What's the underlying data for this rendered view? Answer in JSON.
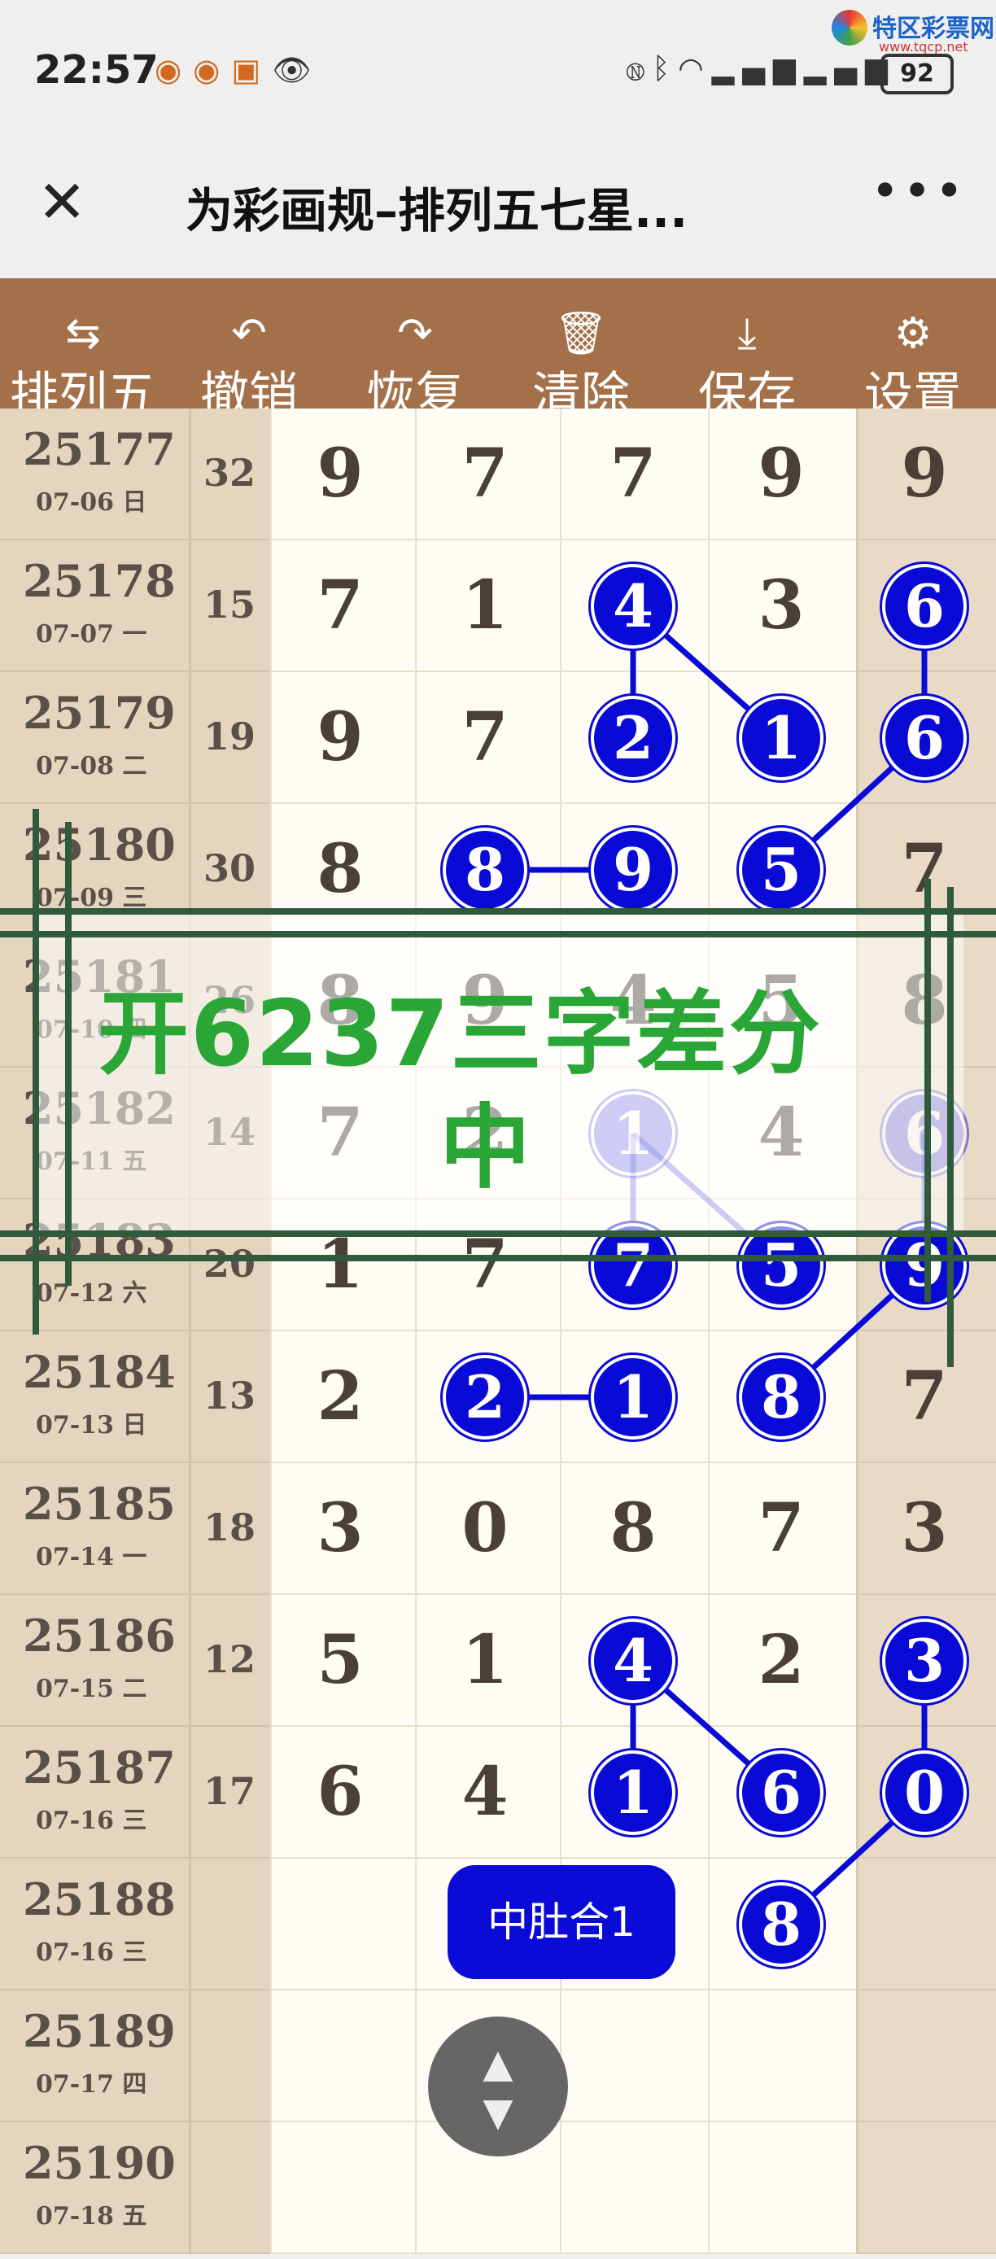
{
  "status_bar": {
    "time": "22:57",
    "battery": "92",
    "left_icons": [
      "weibo-icon",
      "weibo-icon",
      "app-icon",
      "eye-icon"
    ],
    "right_icons": [
      "nfc-icon",
      "bluetooth-icon",
      "wifi-icon",
      "signal-icon",
      "signal-icon"
    ]
  },
  "watermark": {
    "name": "特区彩票网",
    "url": "www.tqcp.net"
  },
  "titlebar": {
    "title": "为彩画规–排列五七星...",
    "close_icon": "close-icon",
    "more_icon": "more-icon"
  },
  "toolbar": {
    "items": [
      {
        "label": "排列五",
        "icon": "swap-icon",
        "glyph": "⇆"
      },
      {
        "label": "撤销",
        "icon": "undo-icon",
        "glyph": "↶"
      },
      {
        "label": "恢复",
        "icon": "redo-icon",
        "glyph": "↷"
      },
      {
        "label": "清除",
        "icon": "trash-icon",
        "glyph": "🗑"
      },
      {
        "label": "保存",
        "icon": "download-icon",
        "glyph": "⤓"
      },
      {
        "label": "设置",
        "icon": "gear-icon",
        "glyph": "⚙"
      }
    ]
  },
  "rows": [
    {
      "issue": "25177",
      "date": "07-06 日",
      "sum": "32",
      "digits": [
        "9",
        "7",
        "7",
        "9",
        "9"
      ]
    },
    {
      "issue": "25178",
      "date": "07-07 一",
      "sum": "15",
      "digits": [
        "7",
        "1",
        "4",
        "3",
        "6"
      ]
    },
    {
      "issue": "25179",
      "date": "07-08 二",
      "sum": "19",
      "digits": [
        "9",
        "7",
        "2",
        "1",
        "6"
      ]
    },
    {
      "issue": "25180",
      "date": "07-09 三",
      "sum": "30",
      "digits": [
        "8",
        "8",
        "9",
        "5",
        "7"
      ]
    },
    {
      "issue": "25181",
      "date": "07-10 四",
      "sum": "26",
      "digits": [
        "8",
        "9",
        "4",
        "5",
        "8"
      ]
    },
    {
      "issue": "25182",
      "date": "07-11 五",
      "sum": "14",
      "digits": [
        "7",
        "2",
        "1",
        "4",
        "6"
      ]
    },
    {
      "issue": "25183",
      "date": "07-12 六",
      "sum": "20",
      "digits": [
        "1",
        "7",
        "7",
        "5",
        "9"
      ]
    },
    {
      "issue": "25184",
      "date": "07-13 日",
      "sum": "13",
      "digits": [
        "2",
        "2",
        "1",
        "8",
        "7"
      ]
    },
    {
      "issue": "25185",
      "date": "07-14 一",
      "sum": "18",
      "digits": [
        "3",
        "0",
        "8",
        "7",
        "3"
      ]
    },
    {
      "issue": "25186",
      "date": "07-15 二",
      "sum": "12",
      "digits": [
        "5",
        "1",
        "4",
        "2",
        "3"
      ]
    },
    {
      "issue": "25187",
      "date": "07-16 三",
      "sum": "17",
      "digits": [
        "6",
        "4",
        "1",
        "6",
        "0"
      ]
    },
    {
      "issue": "25188",
      "date": "07-16 三",
      "sum": "",
      "digits": [
        "",
        "",
        "",
        "8",
        ""
      ]
    },
    {
      "issue": "25189",
      "date": "07-17 四",
      "sum": "",
      "digits": [
        "",
        "",
        "",
        "",
        ""
      ]
    },
    {
      "issue": "25190",
      "date": "07-18 五",
      "sum": "",
      "digits": [
        "",
        "",
        "",
        "",
        ""
      ]
    }
  ],
  "circled": [
    [
      1,
      2
    ],
    [
      1,
      4
    ],
    [
      2,
      2
    ],
    [
      2,
      3
    ],
    [
      2,
      4
    ],
    [
      3,
      1
    ],
    [
      3,
      2
    ],
    [
      3,
      3
    ],
    [
      5,
      2
    ],
    [
      5,
      4
    ],
    [
      6,
      2
    ],
    [
      6,
      3
    ],
    [
      6,
      4
    ],
    [
      7,
      1
    ],
    [
      7,
      2
    ],
    [
      7,
      3
    ],
    [
      9,
      2
    ],
    [
      9,
      4
    ],
    [
      10,
      2
    ],
    [
      10,
      3
    ],
    [
      10,
      4
    ],
    [
      11,
      3
    ]
  ],
  "overlay": {
    "line1": "开6237三字差分",
    "line2": "中"
  },
  "fab": {
    "label": "中肚合1"
  },
  "scroll_button": {
    "up": "▲",
    "down": "▼"
  },
  "colors": {
    "toolbar": "#a4704a",
    "circle": "#0a0ad6",
    "overlay_text": "#2aa637",
    "frame": "#2f5a3c"
  }
}
